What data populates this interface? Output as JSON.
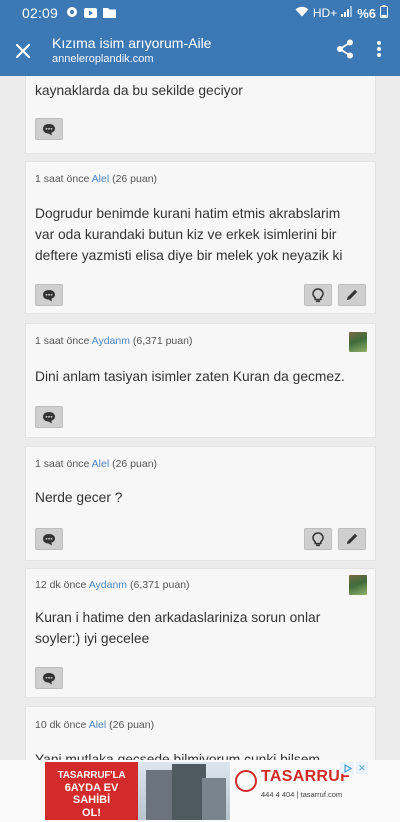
{
  "status_bar": {
    "time": "02:09",
    "network": "HD+",
    "battery": "%6"
  },
  "toolbar": {
    "title": "Kızıma isim arıyorum-Aile",
    "url": "anneleroplandik.com"
  },
  "comments": [
    {
      "text": "kaynaklarda da bu sekilde geciyor"
    },
    {
      "time": "1 saat önce",
      "user": "Alel",
      "points": "(26 puan)",
      "text": "Dogrudur benimde kurani hatim etmis akrabslarim var oda kurandaki butun kiz ve erkek isimlerini bir deftere yazmisti elisa diye bir melek yok neyazik ki"
    },
    {
      "time": "1 saat önce",
      "user": "Aydanm",
      "points": "(6,371 puan)",
      "text": "Dini anlam tasiyan isimler zaten Kuran da gecmez."
    },
    {
      "time": "1 saat önce",
      "user": "Alel",
      "points": "(26 puan)",
      "text": "Nerde gecer ?"
    },
    {
      "time": "12 dk önce",
      "user": "Aydanm",
      "points": "(6,371 puan)",
      "text": "Kuran i hatime den arkadaslariniza sorun onlar soyler:) iyi gecelee"
    },
    {
      "time": "10 dk önce",
      "user": "Alel",
      "points": "(26 puan)",
      "text": "Yani mutlaka gecsede bilmiyorum cunki bilsem"
    }
  ],
  "ad": {
    "line1": "TASARRUF'LA",
    "line2": "6AYDA EV SAHİBİ",
    "line3": "OL!",
    "brand": "TASARRUF",
    "phone": "444 4 404 | tasarruf.com"
  },
  "colors": {
    "primary": "#3c78b4",
    "link": "#4a86c4",
    "ad_red": "#d32b2b"
  }
}
